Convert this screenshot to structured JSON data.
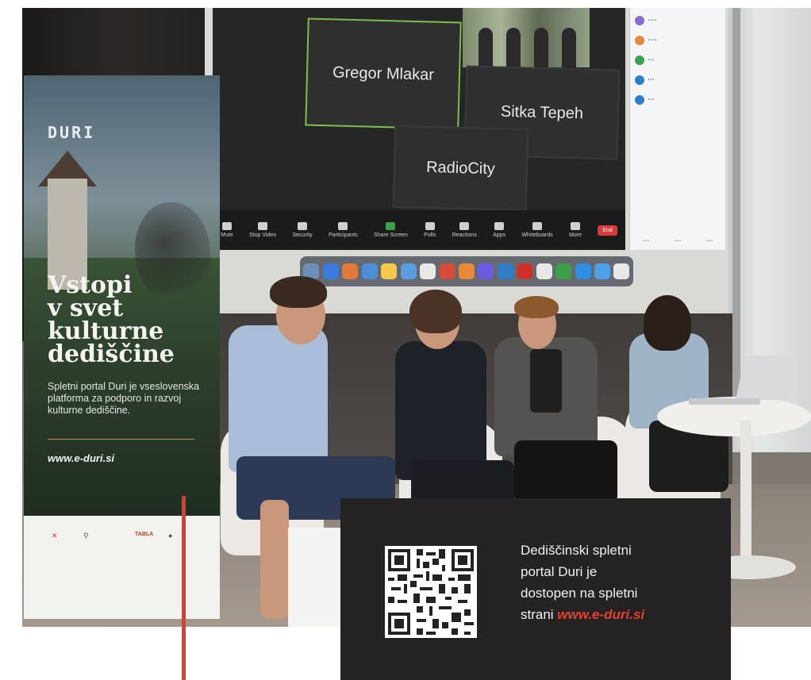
{
  "screen": {
    "tiles": [
      {
        "name": "Gregor Mlakar",
        "active": true
      },
      {
        "name": "Sitka Tepeh",
        "active": false
      },
      {
        "name": "RadioCity",
        "active": false
      }
    ],
    "toolbar": [
      "Mute",
      "Stop Video",
      "Security",
      "Participants",
      "Share Screen",
      "Polls",
      "Reactions",
      "Apps",
      "Whiteboards",
      "More",
      "End"
    ]
  },
  "banner": {
    "logo": "DURI",
    "headline": [
      "Vstopi",
      "v svet",
      "kulturne",
      "dediščine"
    ],
    "body": "Spletni portal Duri je vseslovenska platforma za podporo in razvoj kulturne dediščine.",
    "url": "www.e-duri.si",
    "sponsor_mid": "TABLA"
  },
  "info": {
    "lines": [
      "Dediščinski spletni",
      "portal Duri je",
      "dostopen na spletni"
    ],
    "last_prefix": "strani ",
    "url": "www.e-duri.si",
    "accent": "#e2412e"
  },
  "colors": {
    "overlay_bg": "#252223",
    "marker_red": "#e33a2e"
  }
}
